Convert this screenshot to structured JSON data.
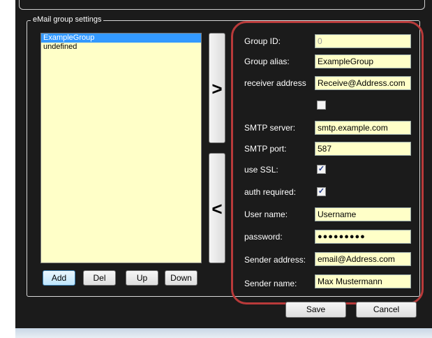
{
  "group_box": {
    "title": "eMail group settings"
  },
  "list": {
    "items": [
      {
        "label": "ExampleGroup",
        "selected": true
      },
      {
        "label": "undefined",
        "selected": false
      }
    ]
  },
  "list_buttons": {
    "add": "Add",
    "del": "Del",
    "up": "Up",
    "down": "Down"
  },
  "move_buttons": {
    "right": ">",
    "left": "<"
  },
  "form": {
    "group_id": {
      "label": "Group ID:",
      "value": "0"
    },
    "group_alias": {
      "label": "Group alias:",
      "value": "ExampleGroup"
    },
    "receiver_address": {
      "label": "receiver address",
      "value": "Receive@Address.com"
    },
    "receiver_checkbox": {
      "checked": false
    },
    "smtp_server": {
      "label": "SMTP server:",
      "value": "smtp.example.com"
    },
    "smtp_port": {
      "label": "SMTP port:",
      "value": "587"
    },
    "use_ssl": {
      "label": "use SSL:",
      "checked": true
    },
    "auth_required": {
      "label": "auth required:",
      "checked": true
    },
    "user_name": {
      "label": "User name:",
      "value": "Username"
    },
    "password": {
      "label": "password:",
      "value": "●●●●●●●●●"
    },
    "sender_address": {
      "label": "Sender address:",
      "value": "email@Address.com"
    },
    "sender_name": {
      "label": "Sender name:",
      "value": "Max Mustermann"
    }
  },
  "footer": {
    "save": "Save",
    "cancel": "Cancel"
  },
  "colors": {
    "window_background": "#1b1b1b",
    "field_background": "#ffffc8",
    "selection": "#3399ff",
    "highlight_outline": "#b93a3a"
  }
}
